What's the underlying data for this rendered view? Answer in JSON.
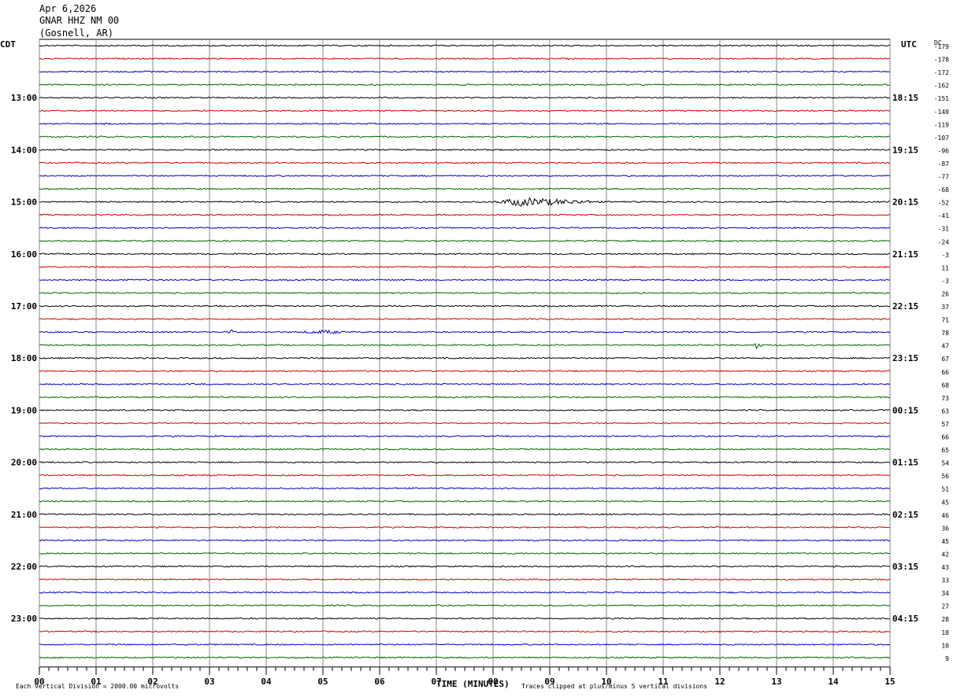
{
  "header": {
    "date": "Apr 6,2026",
    "station": "GNAR HHZ NM 00",
    "location": "(Gosnell, AR)"
  },
  "left_tz": "CDT",
  "right_tz": "UTC",
  "dc_header": "DC",
  "footer": {
    "scale": "Each Vertical Division = 2000.00 microvolts",
    "xlabel": "TIME (MINUTES)",
    "clip": "Traces clipped at plus/minus 5 vertical divisions"
  },
  "chart_data": {
    "type": "line",
    "title": "GNAR HHZ NM 00",
    "xlabel": "TIME (MINUTES)",
    "ylabel": "",
    "x_ticks": [
      "00",
      "01",
      "02",
      "03",
      "04",
      "05",
      "06",
      "07",
      "08",
      "09",
      "10",
      "11",
      "12",
      "13",
      "14",
      "15"
    ],
    "xlim": [
      0,
      15
    ],
    "trace_colors": [
      "#000000",
      "#d00000",
      "#0000c8",
      "#006400"
    ],
    "trace_count": 48,
    "minutes_per_trace": 15,
    "left_hour_labels": [
      "13:00",
      "14:00",
      "15:00",
      "16:00",
      "17:00",
      "18:00",
      "19:00",
      "20:00",
      "21:00",
      "22:00",
      "23:00"
    ],
    "right_hour_labels": [
      "18:15",
      "19:15",
      "20:15",
      "21:15",
      "22:15",
      "23:15",
      "00:15",
      "01:15",
      "02:15",
      "03:15",
      "04:15"
    ],
    "hour_label_first_trace": 4,
    "dc_offsets": [
      "-179",
      "-178",
      "-172",
      "-162",
      "-151",
      "-140",
      "-119",
      "-107",
      "-96",
      "-87",
      "-77",
      "-68",
      "-52",
      "-41",
      "-31",
      "-24",
      "-3",
      "11",
      "-3",
      "26",
      "37",
      "71",
      "78",
      "47",
      "67",
      "66",
      "68",
      "73",
      "63",
      "57",
      "66",
      "65",
      "54",
      "56",
      "51",
      "45",
      "46",
      "36",
      "45",
      "42",
      "43",
      "33",
      "34",
      "27",
      "28",
      "18",
      "10",
      "9"
    ],
    "events": [
      {
        "trace": 12,
        "start_min": 8.0,
        "end_min": 10.0,
        "peak_min": 8.5,
        "amplitude": 2.2,
        "description": "earthquake signal"
      },
      {
        "trace": 22,
        "start_min": 3.3,
        "end_min": 3.5,
        "peak_min": 3.4,
        "amplitude": 1.5,
        "description": "spike"
      },
      {
        "trace": 22,
        "start_min": 4.5,
        "end_min": 5.5,
        "peak_min": 5.0,
        "amplitude": 0.8,
        "description": "noise burst"
      },
      {
        "trace": 23,
        "start_min": 12.6,
        "end_min": 12.75,
        "peak_min": 12.65,
        "amplitude": 2.5,
        "description": "spike"
      }
    ]
  }
}
